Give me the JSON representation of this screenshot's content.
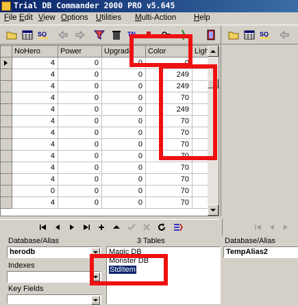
{
  "window": {
    "title": "Trial DB Commander 2000 PRO v5.645"
  },
  "menu": [
    "File",
    "Edit",
    "View",
    "Options",
    "Utilities",
    "Multi-Action",
    "Help"
  ],
  "toolbar_left": [
    "open-folder-icon",
    "table-icon",
    "sql-icon",
    "back-arrow-icon",
    "forward-arrow-icon",
    "filter-icon",
    "trash-icon",
    "tn-icon",
    "red-button-icon",
    "key-icon",
    "run-icon",
    "exit-door-icon"
  ],
  "toolbar_right": [
    "open-folder-icon",
    "table-icon",
    "sql-icon",
    "back-arrow-icon"
  ],
  "grid": {
    "columns": [
      "NoHero",
      "Power",
      "Upgrade",
      "Color",
      "Ligh"
    ],
    "rows": [
      [
        "4",
        "0",
        "0",
        "0",
        ""
      ],
      [
        "4",
        "0",
        "0",
        "249",
        ""
      ],
      [
        "4",
        "0",
        "0",
        "249",
        ""
      ],
      [
        "4",
        "0",
        "0",
        "70",
        ""
      ],
      [
        "4",
        "0",
        "0",
        "249",
        ""
      ],
      [
        "4",
        "0",
        "0",
        "70",
        ""
      ],
      [
        "4",
        "0",
        "0",
        "70",
        ""
      ],
      [
        "4",
        "0",
        "0",
        "70",
        ""
      ],
      [
        "4",
        "0",
        "0",
        "70",
        ""
      ],
      [
        "4",
        "0",
        "0",
        "70",
        ""
      ],
      [
        "4",
        "0",
        "0",
        "70",
        ""
      ],
      [
        "0",
        "0",
        "0",
        "70",
        ""
      ],
      [
        "4",
        "0",
        "0",
        "70",
        ""
      ]
    ]
  },
  "bottom": {
    "database_label": "Database/Alias",
    "database_value": "herodb",
    "indexes_label": "Indexes",
    "key_fields_label": "Key Fields",
    "tables_count": "3 Tables",
    "tables": [
      "Magic DB",
      "Monster DB",
      "StdItem"
    ],
    "selected_table": "StdItem",
    "right_database_label": "Database/Alias",
    "right_database_value": "TempAlias2"
  },
  "colors": {
    "highlight": "#ee1111",
    "selection": "#0a246a"
  }
}
